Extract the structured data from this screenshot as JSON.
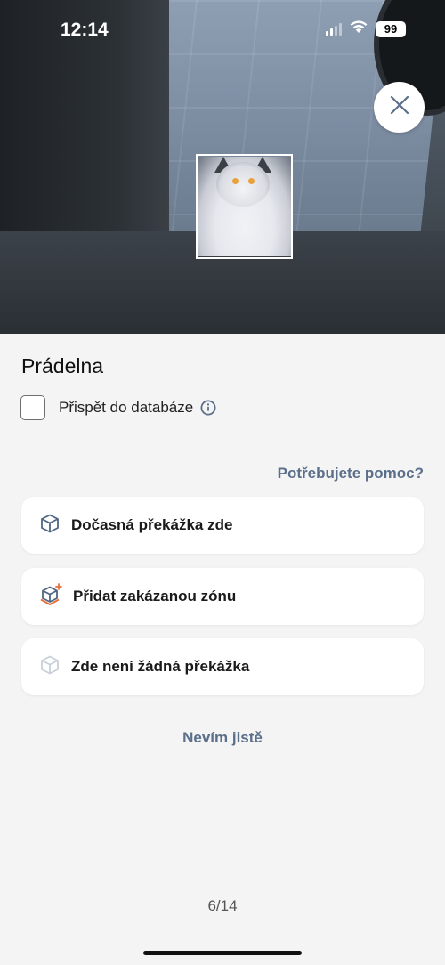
{
  "status_bar": {
    "time": "12:14",
    "battery": "99"
  },
  "camera": {
    "close_icon": "close-icon",
    "detected_object": "cat"
  },
  "room": {
    "title": "Prádelna"
  },
  "contribute": {
    "label": "Přispět do databáze",
    "checked": false,
    "info_icon": "info-icon"
  },
  "help_link": "Potřebujete pomoc?",
  "options": [
    {
      "label": "Dočasná překážka zde",
      "icon": "cube-icon"
    },
    {
      "label": "Přidat zakázanou zónu",
      "icon": "cube-plus-icon"
    },
    {
      "label": "Zde není žádná překážka",
      "icon": "cube-faded-icon"
    }
  ],
  "unsure_button": "Nevím jistě",
  "pager": "6/14",
  "colors": {
    "accent": "#5b6f8a",
    "background": "#f4f4f5",
    "card": "#ffffff",
    "orange": "#e8703a"
  }
}
